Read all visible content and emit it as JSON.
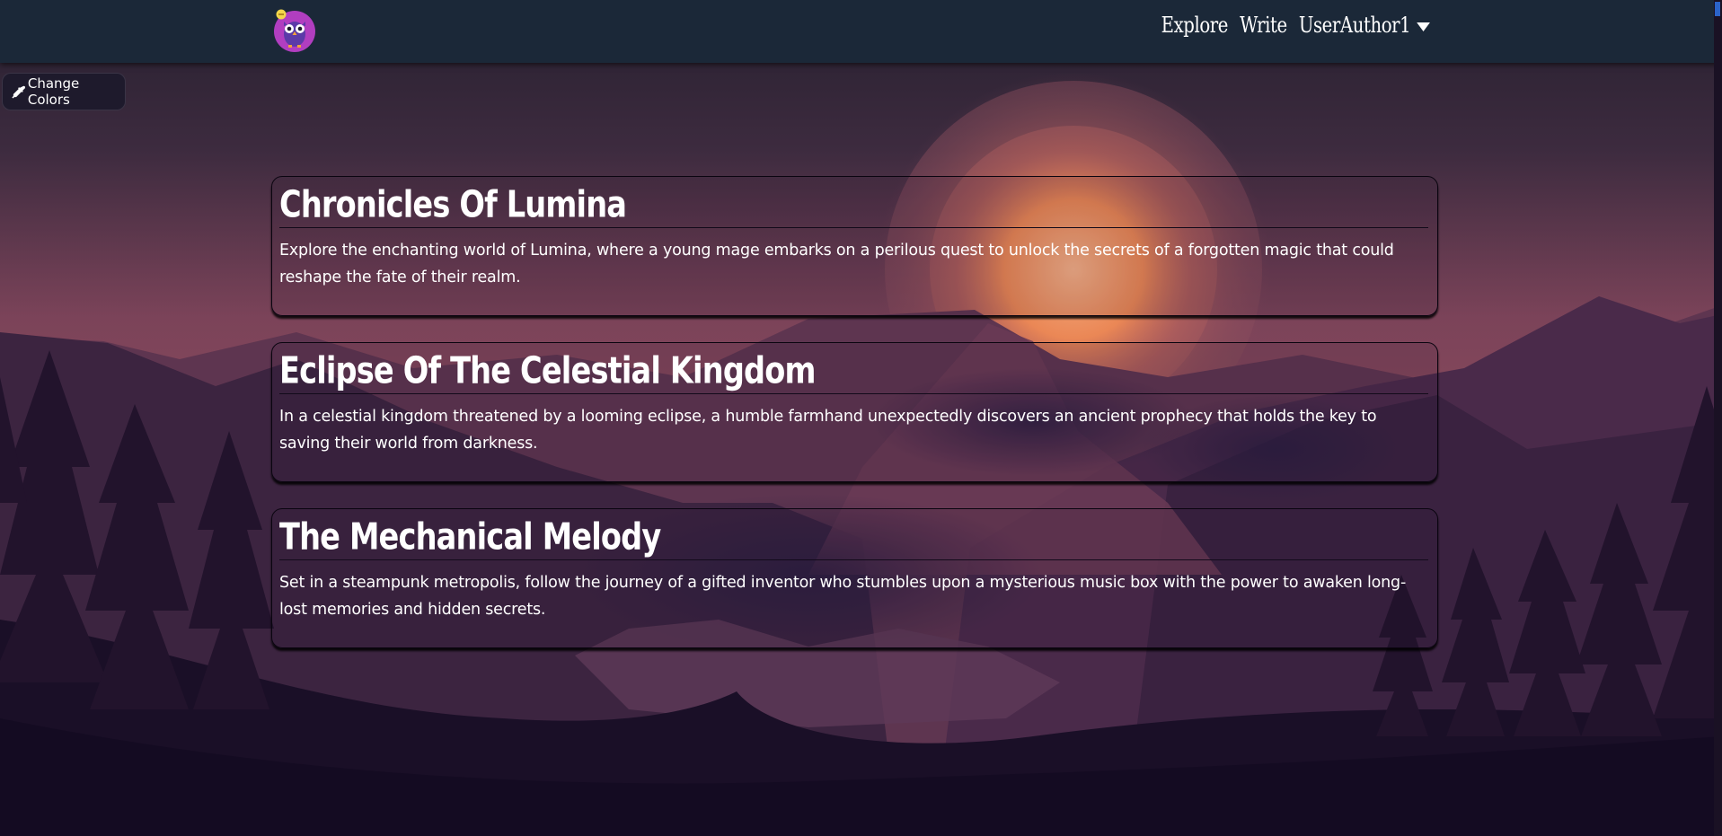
{
  "nav": {
    "logo_icon": "owl-logo-icon",
    "links": [
      "Explore",
      "Write"
    ],
    "user_label": "UserAuthor1"
  },
  "change_colors": {
    "icon": "eyedropper-icon",
    "label": "Change Colors"
  },
  "stories": [
    {
      "title": "Chronicles Of Lumina",
      "description": "Explore the enchanting world of Lumina, where a young mage embarks on a perilous quest to unlock the secrets of a forgotten magic that could reshape the fate of their realm."
    },
    {
      "title": "Eclipse Of The Celestial Kingdom",
      "description": "In a celestial kingdom threatened by a looming eclipse, a humble farmhand unexpectedly discovers an ancient prophecy that holds the key to saving their world from darkness."
    },
    {
      "title": "The Mechanical Melody",
      "description": "Set in a steampunk metropolis, follow the journey of a gifted inventor who stumbles upon a mysterious music box with the power to awaken long-lost memories and hidden secrets."
    }
  ],
  "colors": {
    "navbar": "#1b2838",
    "sky_top": "#2a2035",
    "sky_mid": "#7a3f58",
    "sun": "#f08a50",
    "ground": "#140b22"
  }
}
